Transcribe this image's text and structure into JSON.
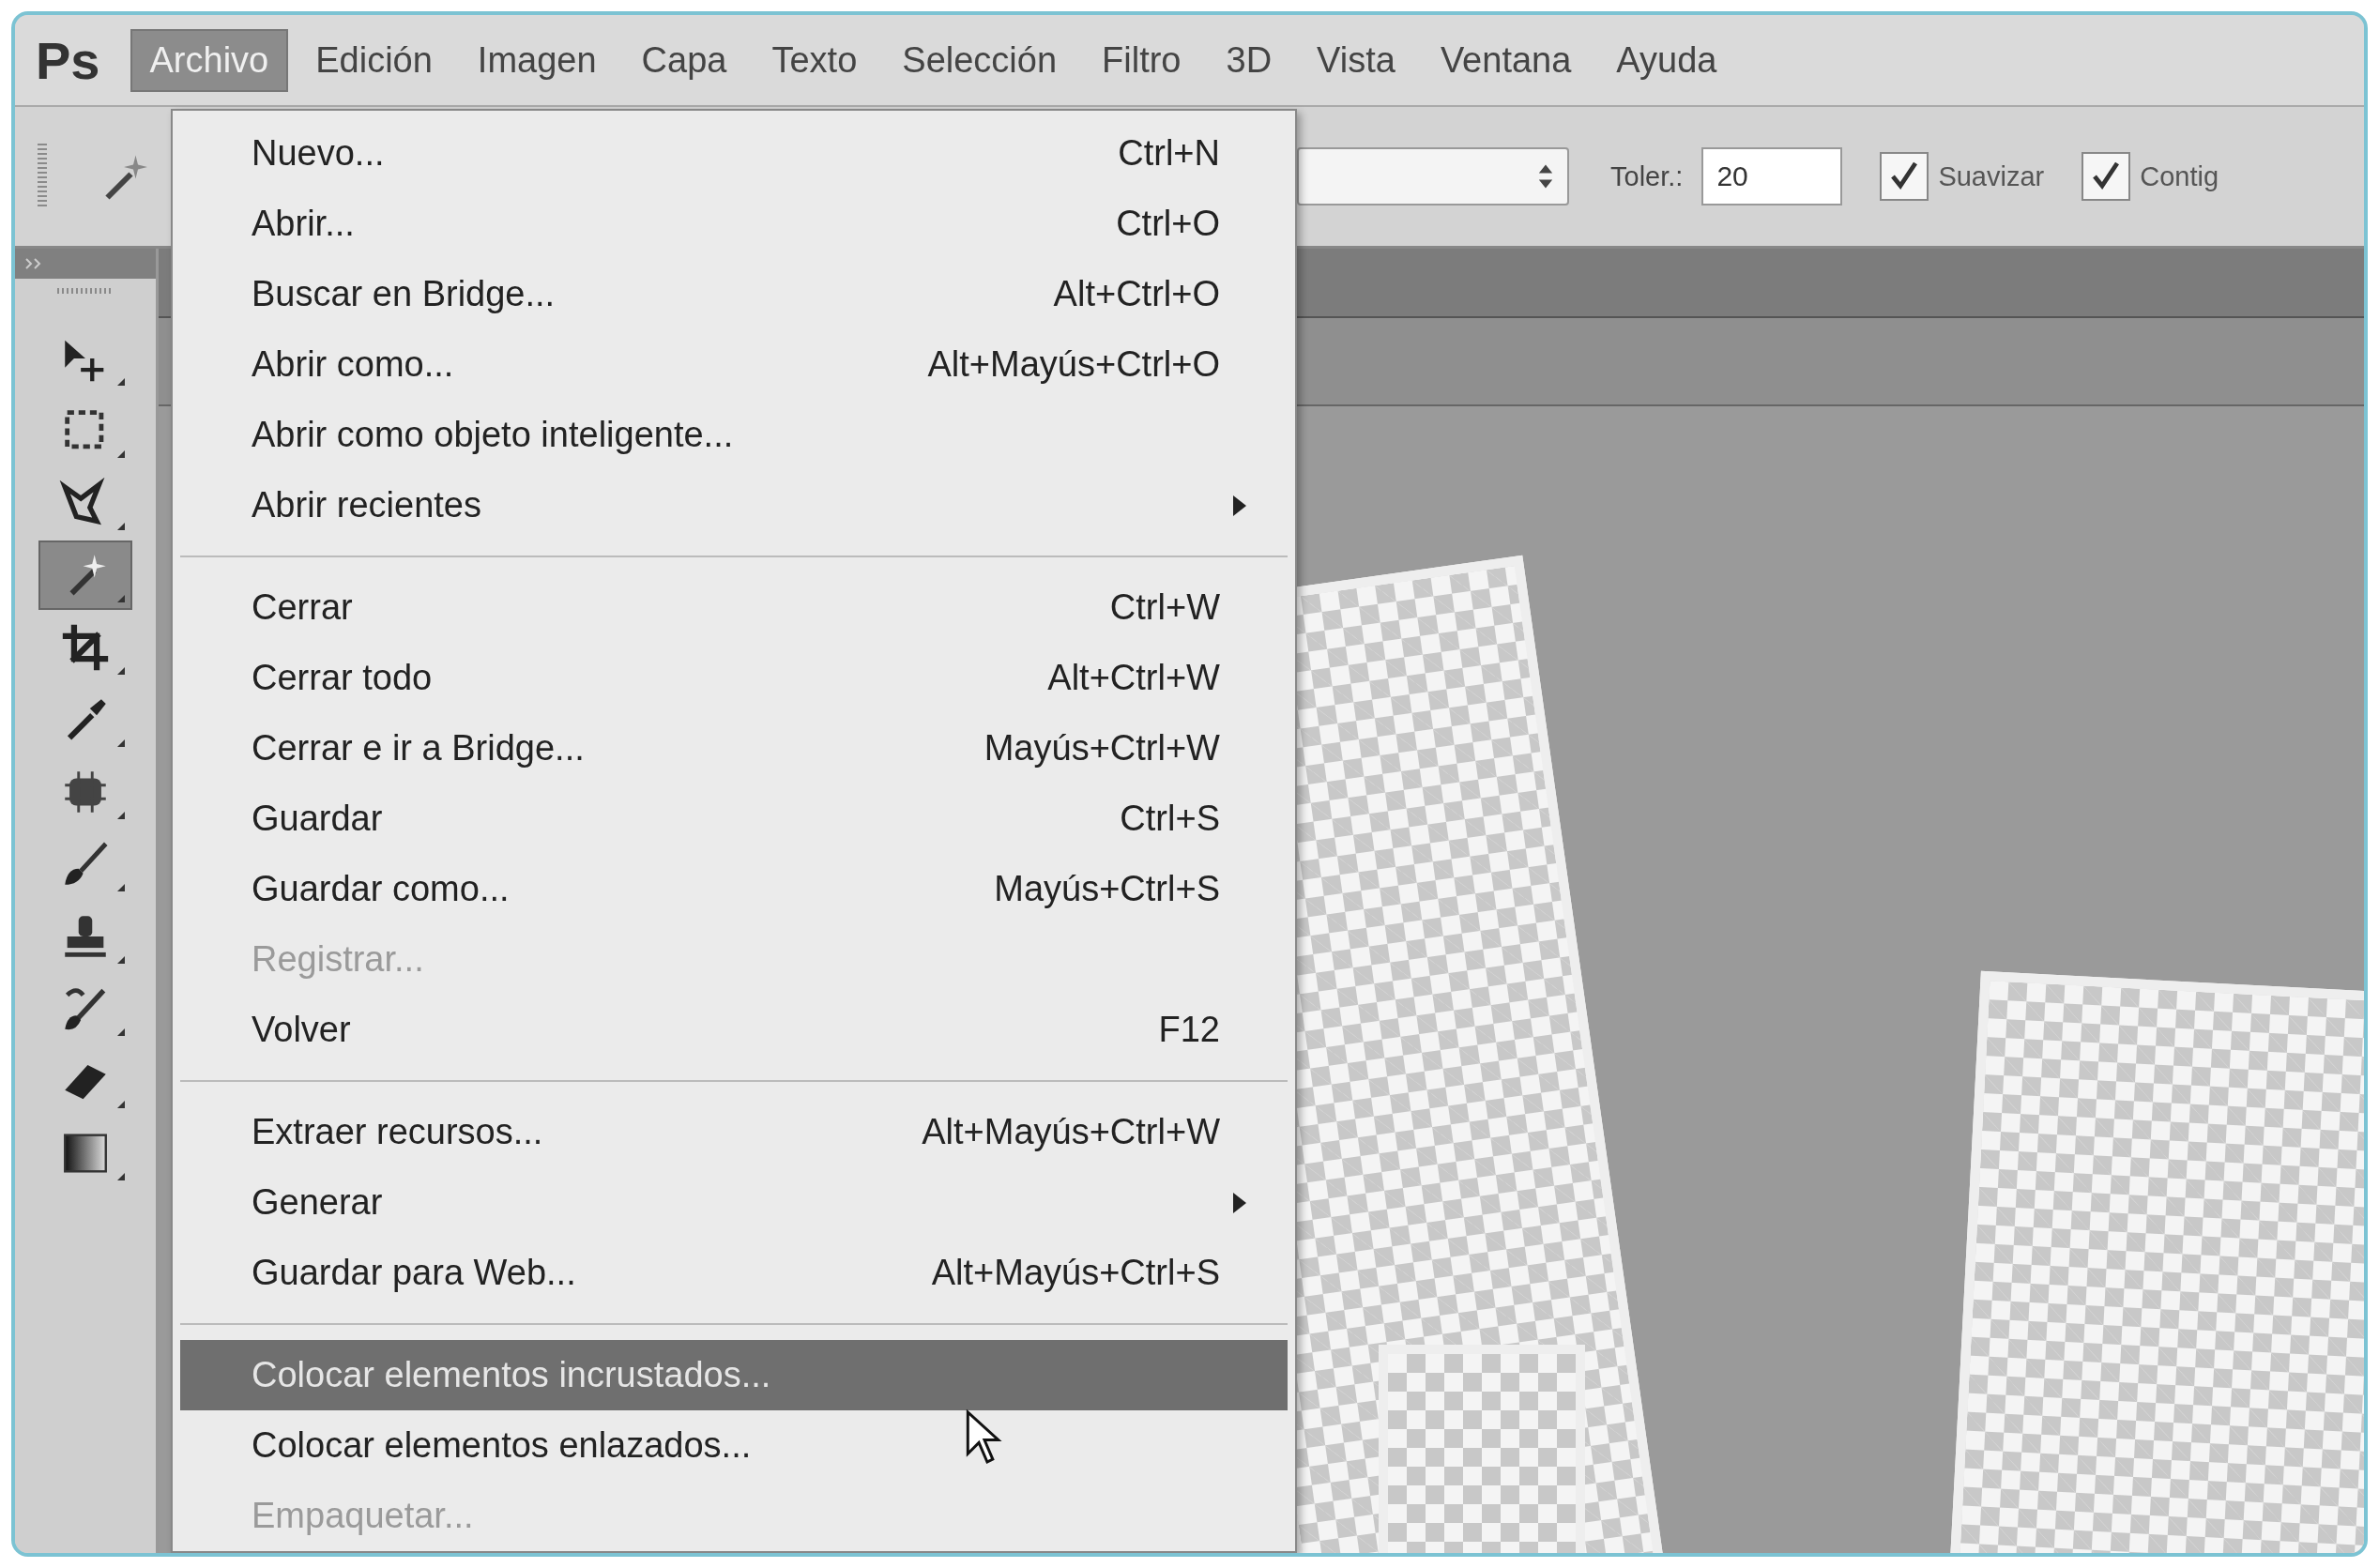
{
  "app_logo": "Ps",
  "menu_bar": [
    {
      "label": "Archivo",
      "selected": true
    },
    {
      "label": "Edición",
      "selected": false
    },
    {
      "label": "Imagen",
      "selected": false
    },
    {
      "label": "Capa",
      "selected": false
    },
    {
      "label": "Texto",
      "selected": false
    },
    {
      "label": "Selección",
      "selected": false
    },
    {
      "label": "Filtro",
      "selected": false
    },
    {
      "label": "3D",
      "selected": false
    },
    {
      "label": "Vista",
      "selected": false
    },
    {
      "label": "Ventana",
      "selected": false
    },
    {
      "label": "Ayuda",
      "selected": false
    }
  ],
  "options_bar": {
    "tolerance": {
      "label": "Toler.:",
      "value": "20"
    },
    "checkboxes": [
      {
        "label": "Suavizar",
        "checked": true
      },
      {
        "label": "Contig",
        "checked": true
      }
    ]
  },
  "toolbar": {
    "tools": [
      {
        "kind": "move",
        "selected": false
      },
      {
        "kind": "marquee",
        "selected": false
      },
      {
        "kind": "lasso",
        "selected": false
      },
      {
        "kind": "wand",
        "selected": true
      },
      {
        "kind": "crop",
        "selected": false
      },
      {
        "kind": "eyedropper",
        "selected": false
      },
      {
        "kind": "healing",
        "selected": false
      },
      {
        "kind": "brush",
        "selected": false
      },
      {
        "kind": "stamp",
        "selected": false
      },
      {
        "kind": "history",
        "selected": false
      },
      {
        "kind": "eraser",
        "selected": false
      },
      {
        "kind": "gradient",
        "selected": false
      }
    ]
  },
  "file_menu": {
    "items": [
      {
        "kind": "item",
        "label": "Nuevo...",
        "shortcut": "Ctrl+N",
        "submenu": false,
        "disabled": false,
        "selected": false
      },
      {
        "kind": "item",
        "label": "Abrir...",
        "shortcut": "Ctrl+O",
        "submenu": false,
        "disabled": false,
        "selected": false
      },
      {
        "kind": "item",
        "label": "Buscar en Bridge...",
        "shortcut": "Alt+Ctrl+O",
        "submenu": false,
        "disabled": false,
        "selected": false
      },
      {
        "kind": "item",
        "label": "Abrir como...",
        "shortcut": "Alt+Mayús+Ctrl+O",
        "submenu": false,
        "disabled": false,
        "selected": false
      },
      {
        "kind": "item",
        "label": "Abrir como objeto inteligente...",
        "submenu": false,
        "disabled": false,
        "selected": false
      },
      {
        "kind": "item",
        "label": "Abrir recientes",
        "submenu": true,
        "disabled": false,
        "selected": false
      },
      {
        "kind": "separator"
      },
      {
        "kind": "item",
        "label": "Cerrar",
        "shortcut": "Ctrl+W",
        "submenu": false,
        "disabled": false,
        "selected": false
      },
      {
        "kind": "item",
        "label": "Cerrar todo",
        "shortcut": "Alt+Ctrl+W",
        "submenu": false,
        "disabled": false,
        "selected": false
      },
      {
        "kind": "item",
        "label": "Cerrar e ir a Bridge...",
        "shortcut": "Mayús+Ctrl+W",
        "submenu": false,
        "disabled": false,
        "selected": false
      },
      {
        "kind": "item",
        "label": "Guardar",
        "shortcut": "Ctrl+S",
        "submenu": false,
        "disabled": false,
        "selected": false
      },
      {
        "kind": "item",
        "label": "Guardar como...",
        "shortcut": "Mayús+Ctrl+S",
        "submenu": false,
        "disabled": false,
        "selected": false
      },
      {
        "kind": "item",
        "label": "Registrar...",
        "submenu": false,
        "disabled": true,
        "selected": false
      },
      {
        "kind": "item",
        "label": "Volver",
        "shortcut": "F12",
        "submenu": false,
        "disabled": false,
        "selected": false
      },
      {
        "kind": "separator"
      },
      {
        "kind": "item",
        "label": "Extraer recursos...",
        "shortcut": "Alt+Mayús+Ctrl+W",
        "submenu": false,
        "disabled": false,
        "selected": false
      },
      {
        "kind": "item",
        "label": "Generar",
        "submenu": true,
        "disabled": false,
        "selected": false
      },
      {
        "kind": "item",
        "label": "Guardar para Web...",
        "shortcut": "Alt+Mayús+Ctrl+S",
        "submenu": false,
        "disabled": false,
        "selected": false
      },
      {
        "kind": "separator"
      },
      {
        "kind": "item",
        "label": "Colocar elementos incrustados...",
        "submenu": false,
        "disabled": false,
        "selected": true
      },
      {
        "kind": "item",
        "label": "Colocar elementos enlazados...",
        "submenu": false,
        "disabled": false,
        "selected": false
      },
      {
        "kind": "item",
        "label": "Empaquetar...",
        "submenu": false,
        "disabled": true,
        "selected": false
      }
    ]
  }
}
